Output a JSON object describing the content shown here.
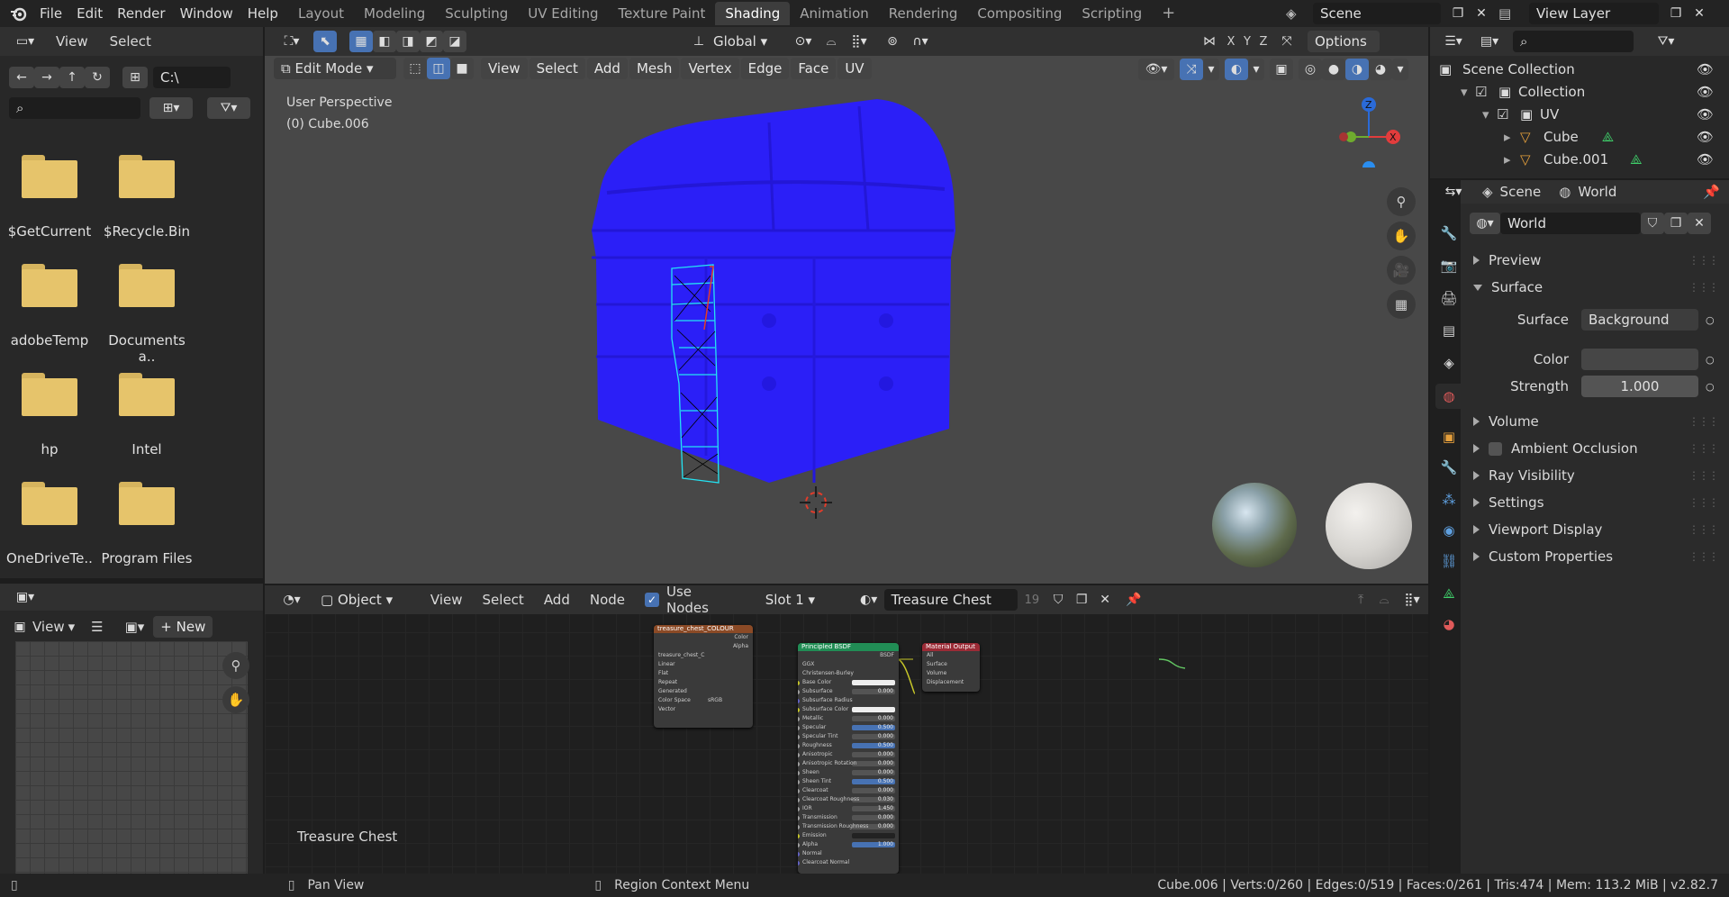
{
  "topbar": {
    "menus": [
      "File",
      "Edit",
      "Render",
      "Window",
      "Help"
    ],
    "workspaces": [
      "Layout",
      "Modeling",
      "Sculpting",
      "UV Editing",
      "Texture Paint",
      "Shading",
      "Animation",
      "Rendering",
      "Compositing",
      "Scripting"
    ],
    "active_workspace": "Shading",
    "add_tab": "+",
    "scene_name": "Scene",
    "view_layer_name": "View Layer"
  },
  "file_browser": {
    "menus": [
      "View",
      "Select"
    ],
    "path": "C:\\",
    "folders": [
      "$GetCurrent",
      "$Recycle.Bin",
      "adobeTemp",
      "Documents a..",
      "hp",
      "Intel",
      "OneDriveTe..",
      "Program Files"
    ]
  },
  "viewport": {
    "orientation_label": "Global",
    "options_label": "Options",
    "mode": "Edit Mode",
    "menus": [
      "View",
      "Select",
      "Add",
      "Mesh",
      "Vertex",
      "Edge",
      "Face",
      "UV"
    ],
    "axis_labels": [
      "X",
      "Y",
      "Z"
    ],
    "perspective_label": "User Perspective",
    "object_label": "(0) Cube.006",
    "colors": {
      "mesh": "#2b1ff7",
      "background": "#484848",
      "selection": "#24e3f2"
    }
  },
  "image_editor": {
    "view_label": "View",
    "new_label": "New"
  },
  "node_editor": {
    "object_label": "Object",
    "menus": [
      "View",
      "Select",
      "Add",
      "Node"
    ],
    "use_nodes_label": "Use Nodes",
    "use_nodes_checked": true,
    "slot_label": "Slot 1",
    "material_name": "Treasure Chest",
    "material_users": "19",
    "footer_material": "Treasure Chest",
    "image_node": {
      "title": "treasure_chest_COLOUR",
      "outputs": [
        "Color",
        "Alpha"
      ],
      "image_name": "treasure_chest_C",
      "fields": [
        "Linear",
        "Flat",
        "Repeat",
        "Generated"
      ],
      "colorspace_label": "Color Space",
      "colorspace_value": "sRGB",
      "vector_label": "Vector"
    },
    "bsdf_node": {
      "title": "Principled BSDF",
      "output": "BSDF",
      "dropdowns": [
        "GGX",
        "Christensen-Burley"
      ],
      "inputs": [
        {
          "name": "Base Color",
          "value": ""
        },
        {
          "name": "Subsurface",
          "value": "0.000"
        },
        {
          "name": "Subsurface Radius",
          "value": ""
        },
        {
          "name": "Subsurface Color",
          "value": ""
        },
        {
          "name": "Metallic",
          "value": "0.000"
        },
        {
          "name": "Specular",
          "value": "0.500"
        },
        {
          "name": "Specular Tint",
          "value": "0.000"
        },
        {
          "name": "Roughness",
          "value": "0.500"
        },
        {
          "name": "Anisotropic",
          "value": "0.000"
        },
        {
          "name": "Anisotropic Rotation",
          "value": "0.000"
        },
        {
          "name": "Sheen",
          "value": "0.000"
        },
        {
          "name": "Sheen Tint",
          "value": "0.500"
        },
        {
          "name": "Clearcoat",
          "value": "0.000"
        },
        {
          "name": "Clearcoat Roughness",
          "value": "0.030"
        },
        {
          "name": "IOR",
          "value": "1.450"
        },
        {
          "name": "Transmission",
          "value": "0.000"
        },
        {
          "name": "Transmission Roughness",
          "value": "0.000"
        },
        {
          "name": "Emission",
          "value": ""
        },
        {
          "name": "Alpha",
          "value": "1.000"
        },
        {
          "name": "Normal",
          "value": ""
        },
        {
          "name": "Clearcoat Normal",
          "value": ""
        }
      ]
    },
    "output_node": {
      "title": "Material Output",
      "target": "All",
      "inputs": [
        "Surface",
        "Volume",
        "Displacement"
      ]
    }
  },
  "outliner": {
    "rows": [
      {
        "label": "Scene Collection"
      },
      {
        "label": "Collection"
      },
      {
        "label": "UV"
      },
      {
        "label": "Cube"
      },
      {
        "label": "Cube.001"
      }
    ]
  },
  "properties": {
    "tabs": [
      "Scene",
      "World"
    ],
    "world_name": "World",
    "panels": {
      "preview": "Preview",
      "surface": "Surface",
      "volume": "Volume",
      "ambient_occlusion": "Ambient Occlusion",
      "ray_visibility": "Ray Visibility",
      "settings": "Settings",
      "viewport_display": "Viewport Display",
      "custom_properties": "Custom Properties"
    },
    "surface_label": "Surface",
    "surface_value": "Background",
    "color_label": "Color",
    "strength_label": "Strength",
    "strength_value": "1.000"
  },
  "statusbar": {
    "pan_view": "Pan View",
    "region_context_menu": "Region Context Menu",
    "stats": "Cube.006 | Verts:0/260 | Edges:0/519 | Faces:0/261 | Tris:474 | Mem: 113.2 MiB | v2.82.7"
  }
}
